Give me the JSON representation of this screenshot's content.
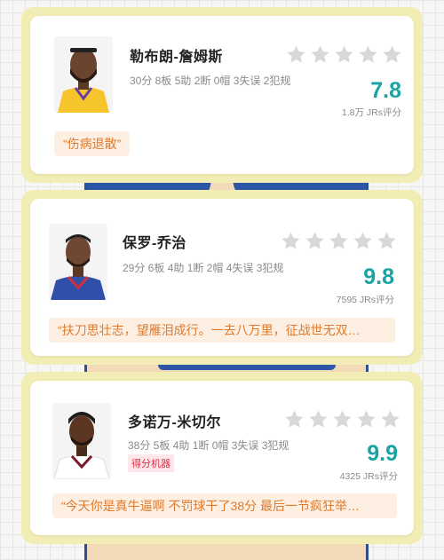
{
  "players": [
    {
      "name": "勒布朗-詹姆斯",
      "stats": "30分 8板 5助 2断 0帽 3失误 2犯规",
      "score": "7.8",
      "rating_count": "1.8万 JRs评分",
      "quote": "“伤病退散”",
      "jersey_color": "#f5c52b",
      "stars": 0
    },
    {
      "name": "保罗-乔治",
      "stats": "29分 6板 4助 1断 2帽 4失误 3犯规",
      "score": "9.8",
      "rating_count": "7595 JRs评分",
      "quote": "“扶刀思壮志，望雁泪成行。一去八万里，征战世无双…",
      "jersey_color": "#2f4fa8",
      "stars": 0
    },
    {
      "name": "多诺万-米切尔",
      "stats": "38分 5板 4助 1断 0帽 3失误 3犯规",
      "tag": "得分机器",
      "score": "9.9",
      "rating_count": "4325 JRs评分",
      "quote": "“今天你是真牛逼啊 不罚球干了38分 最后一节疯狂举…",
      "jersey_color": "#ffffff",
      "stars": 0
    }
  ],
  "colors": {
    "score": "#1aa3a3",
    "quote_text": "#e07a2c",
    "quote_bg": "#fdf0e3",
    "frame": "#f2edb5",
    "star_empty": "#d8d8d8"
  }
}
